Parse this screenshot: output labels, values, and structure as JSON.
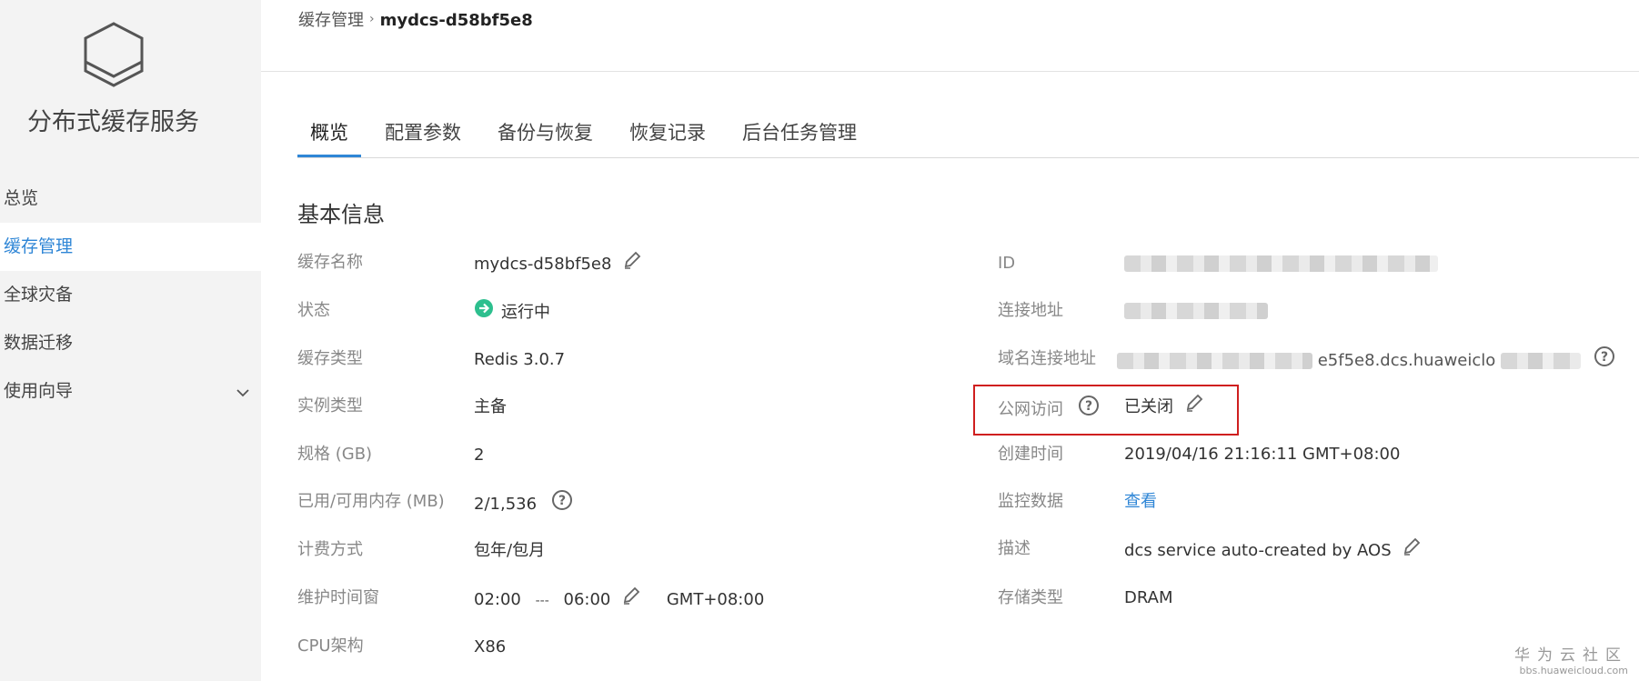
{
  "sidebar": {
    "service_name": "分布式缓存服务",
    "items": [
      {
        "label": "总览"
      },
      {
        "label": "缓存管理"
      },
      {
        "label": "全球灾备"
      },
      {
        "label": "数据迁移"
      },
      {
        "label": "使用向导"
      }
    ]
  },
  "breadcrumb": {
    "parent": "缓存管理",
    "current": "mydcs-d58bf5e8"
  },
  "tabs": [
    {
      "label": "概览"
    },
    {
      "label": "配置参数"
    },
    {
      "label": "备份与恢复"
    },
    {
      "label": "恢复记录"
    },
    {
      "label": "后台任务管理"
    }
  ],
  "section_title": "基本信息",
  "left_fields": {
    "cache_name": {
      "label": "缓存名称",
      "value": "mydcs-d58bf5e8"
    },
    "status": {
      "label": "状态",
      "value": "运行中"
    },
    "cache_type": {
      "label": "缓存类型",
      "value": "Redis 3.0.7"
    },
    "instance_type": {
      "label": "实例类型",
      "value": "主备"
    },
    "spec": {
      "label": "规格 (GB)",
      "value": "2"
    },
    "memory": {
      "label": "已用/可用内存 (MB)",
      "value": "2/1,536"
    },
    "billing": {
      "label": "计费方式",
      "value": "包年/包月"
    },
    "maintenance": {
      "label": "维护时间窗",
      "start": "02:00",
      "dash": "---",
      "end": "06:00",
      "tz": "GMT+08:00"
    },
    "cpu": {
      "label": "CPU架构",
      "value": "X86"
    }
  },
  "right_fields": {
    "id": {
      "label": "ID"
    },
    "address": {
      "label": "连接地址"
    },
    "domain": {
      "label": "域名连接地址",
      "value_visible": "e5f5e8.dcs.huaweiclo"
    },
    "public_access": {
      "label": "公网访问",
      "value": "已关闭"
    },
    "created": {
      "label": "创建时间",
      "value": "2019/04/16 21:16:11 GMT+08:00"
    },
    "monitor": {
      "label": "监控数据",
      "value": "查看"
    },
    "description": {
      "label": "描述",
      "value": "dcs service auto-created by AOS"
    },
    "storage": {
      "label": "存储类型",
      "value": "DRAM"
    }
  },
  "watermark": {
    "name": "华为云社区",
    "url": "bbs.huaweicloud.com"
  },
  "colors": {
    "accent": "#2f86d6",
    "status_green": "#2dbf8e",
    "highlight_red": "#cf1f1f"
  }
}
